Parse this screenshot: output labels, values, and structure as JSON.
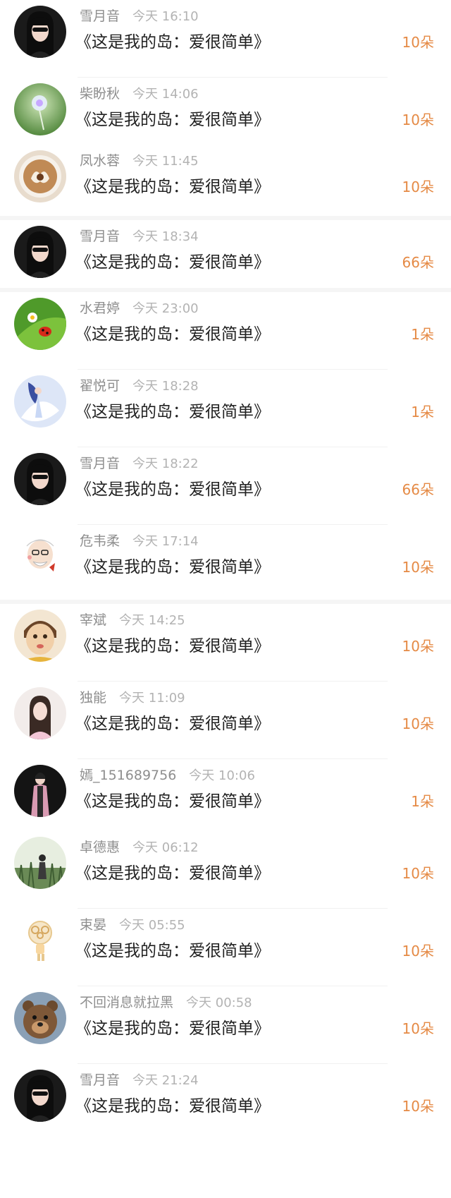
{
  "rows": [
    {
      "name": "雪月音",
      "time": "今天 16:10",
      "title": "《这是我的岛：爱很简单》",
      "count": "10朵",
      "avatar": "dark-hair-sunglasses"
    },
    {
      "name": "柴盼秋",
      "time": "今天 14:06",
      "title": "《这是我的岛：爱很简单》",
      "count": "10朵",
      "avatar": "green-dandelion"
    },
    {
      "name": "凤水蓉",
      "time": "今天 11:45",
      "title": "《这是我的岛：爱很简单》",
      "count": "10朵",
      "avatar": "latte-art"
    },
    {
      "name": "雪月音",
      "time": "今天 18:34",
      "title": "《这是我的岛：爱很简单》",
      "count": "66朵",
      "avatar": "dark-hair-sunglasses"
    },
    {
      "name": "水君婷",
      "time": "今天 23:00",
      "title": "《这是我的岛：爱很简单》",
      "count": "1朵",
      "avatar": "green-ladybug"
    },
    {
      "name": "翟悦可",
      "time": "今天 18:28",
      "title": "《这是我的岛：爱很简单》",
      "count": "1朵",
      "avatar": "anime-dancer"
    },
    {
      "name": "雪月音",
      "time": "今天 18:22",
      "title": "《这是我的岛：爱很简单》",
      "count": "66朵",
      "avatar": "dark-hair-sunglasses"
    },
    {
      "name": "危韦柔",
      "time": "今天 17:14",
      "title": "《这是我的岛：爱很简单》",
      "count": "10朵",
      "avatar": "cartoon-old-man"
    },
    {
      "name": "宰斌",
      "time": "今天 14:25",
      "title": "《这是我的岛：爱很简单》",
      "count": "10朵",
      "avatar": "child-face"
    },
    {
      "name": "独能",
      "time": "今天 11:09",
      "title": "《这是我的岛：爱很简单》",
      "count": "10朵",
      "avatar": "girl-portrait"
    },
    {
      "name": "嫣_151689756",
      "time": "今天 10:06",
      "title": "《这是我的岛：爱很简单》",
      "count": "1朵",
      "avatar": "pink-coat-figure"
    },
    {
      "name": "卓德惠",
      "time": "今天 06:12",
      "title": "《这是我的岛：爱很简单》",
      "count": "10朵",
      "avatar": "grass-girl"
    },
    {
      "name": "束晏",
      "time": "今天 05:55",
      "title": "《这是我的岛：爱很简单》",
      "count": "10朵",
      "avatar": "curly-cartoon"
    },
    {
      "name": "不回消息就拉黑",
      "time": "今天 00:58",
      "title": "《这是我的岛：爱很简单》",
      "count": "10朵",
      "avatar": "bear-cartoon"
    },
    {
      "name": "雪月音",
      "time": "今天 21:24",
      "title": "《这是我的岛：爱很简单》",
      "count": "10朵",
      "avatar": "dark-hair-sunglasses"
    }
  ],
  "colors": {
    "accent": "#e58a45",
    "name": "#8e8e8e",
    "time": "#b3b3b3",
    "title": "#222222"
  }
}
